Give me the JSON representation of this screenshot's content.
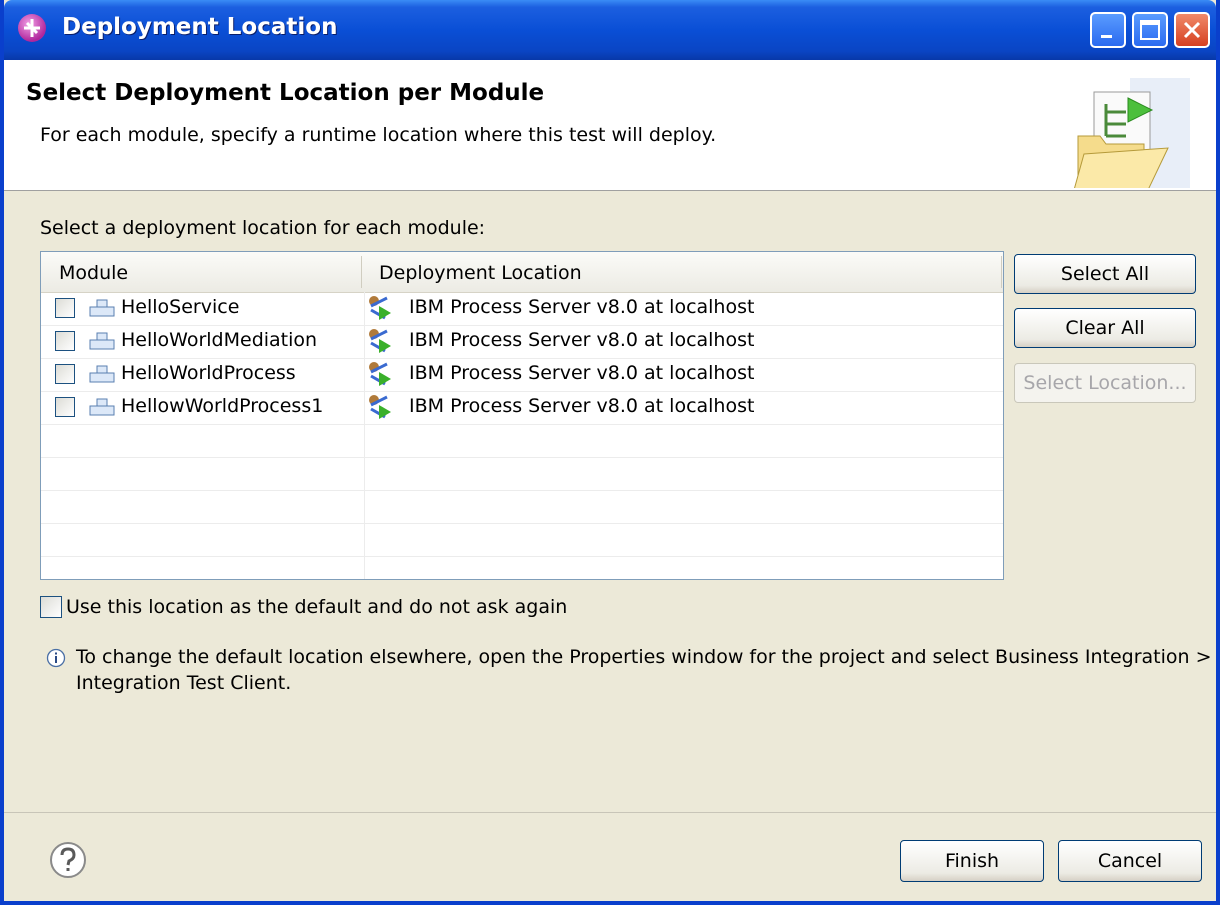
{
  "window": {
    "title": "Deployment Location",
    "controls": [
      "minimize-icon",
      "maximize-icon",
      "close-icon"
    ]
  },
  "header": {
    "title": "Select Deployment Location per Module",
    "description": "For each module, specify a runtime location where this test will deploy."
  },
  "main": {
    "instruction": "Select a deployment location for each module:",
    "table": {
      "columns": [
        "Module",
        "Deployment Location"
      ],
      "rows": [
        {
          "module": "HelloService",
          "location": "IBM Process Server v8.0 at localhost",
          "checked": false
        },
        {
          "module": "HelloWorldMediation",
          "location": "IBM Process Server v8.0 at localhost",
          "checked": false
        },
        {
          "module": "HelloWorldProcess",
          "location": "IBM Process Server v8.0 at localhost",
          "checked": false
        },
        {
          "module": "HellowWorldProcess1",
          "location": "IBM Process Server v8.0 at localhost",
          "checked": false
        }
      ]
    },
    "buttons": {
      "select_all": "Select All",
      "clear_all": "Clear All",
      "select_location": "Select Location..."
    },
    "default_checkbox_label": "Use this location as the default and do not ask again",
    "info_line1": "To change the default location elsewhere, open the Properties window for the project and select Business Integration >",
    "info_line2": "Integration Test Client."
  },
  "footer": {
    "finish": "Finish",
    "cancel": "Cancel"
  },
  "colors": {
    "titlebar": "#0a4fd6",
    "dialog_bg": "#ece9d8",
    "table_border": "#7f9db9"
  }
}
